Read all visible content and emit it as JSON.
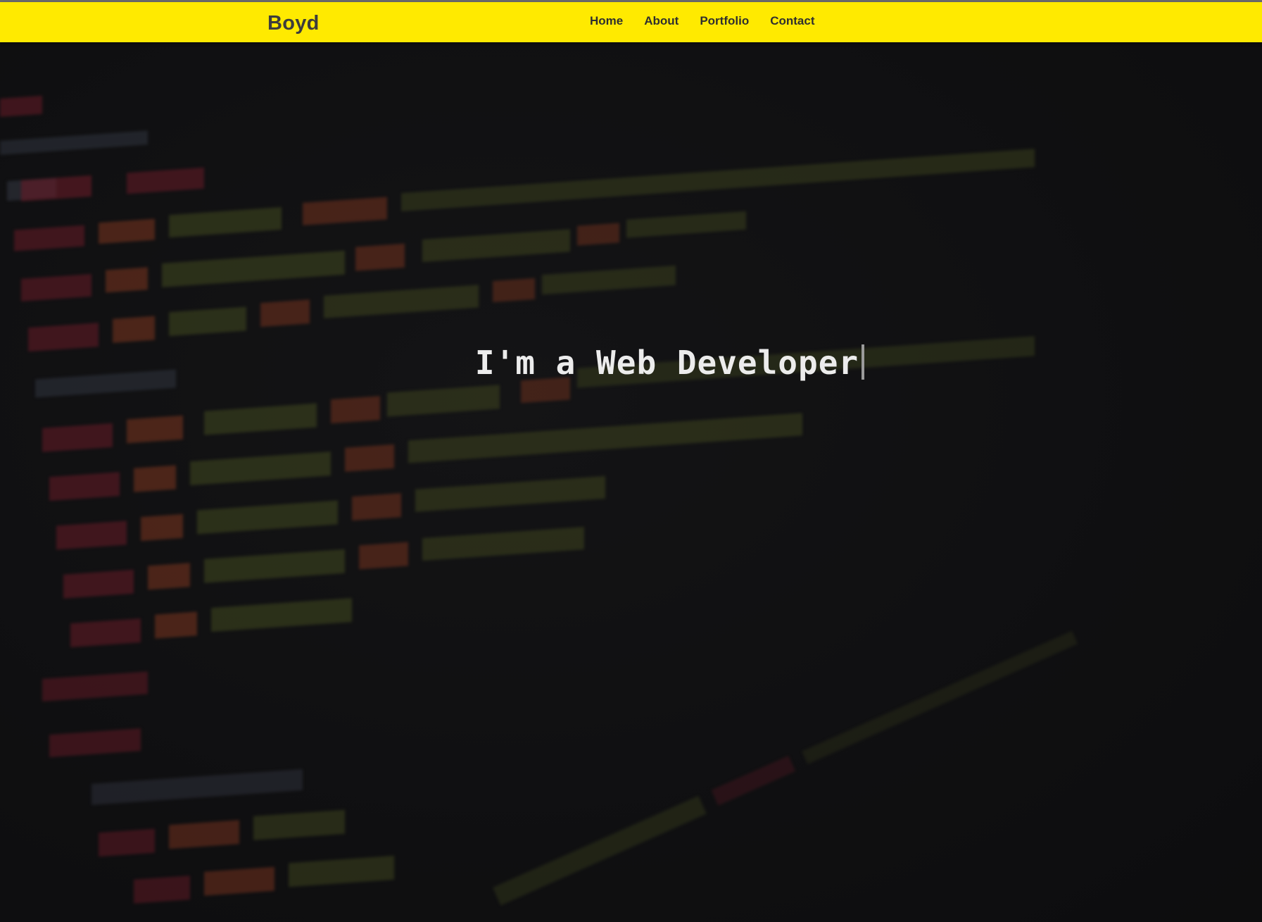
{
  "navbar": {
    "brand": "Boyd",
    "links": [
      "Home",
      "About",
      "Portfolio",
      "Contact"
    ]
  },
  "hero": {
    "headline": "I'm a Web Developer"
  },
  "colors": {
    "navbar_bg": "#ffea00",
    "page_bg": "#141415",
    "code_tag": "#b0283c",
    "code_attr": "#c4512c",
    "code_string": "#6e7a2e",
    "code_punct": "#5c6478"
  }
}
